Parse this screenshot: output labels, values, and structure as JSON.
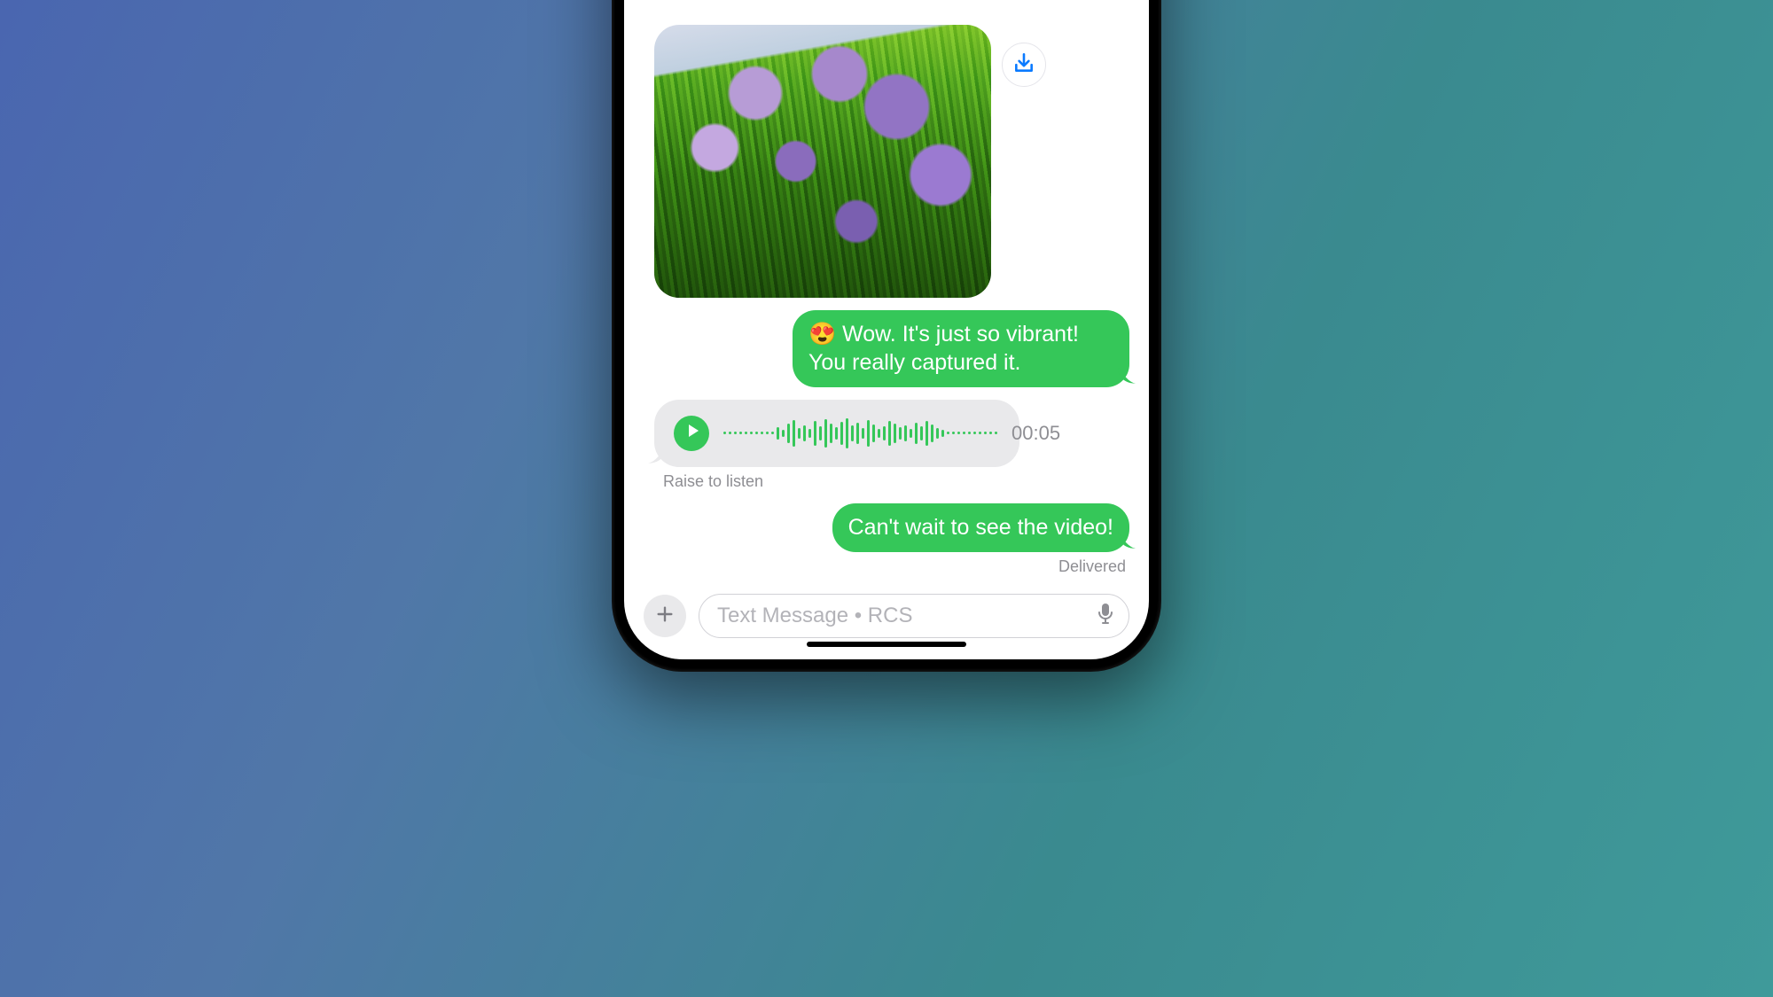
{
  "messages": {
    "photo_alt": "Lavender flowers photo",
    "outgoing1": "😍  Wow. It's just so vibrant! You really captured it.",
    "audio": {
      "duration": "00:05",
      "hint": "Raise to listen"
    },
    "outgoing2": "Can't wait to see the video!",
    "status": "Delivered"
  },
  "input": {
    "placeholder": "Text Message • RCS"
  },
  "colors": {
    "green": "#35c759",
    "gray_bubble": "#e9e9eb",
    "gray_text": "#8e8e93"
  },
  "waveform_heights": [
    3,
    3,
    3,
    3,
    3,
    3,
    3,
    3,
    3,
    3,
    14,
    8,
    22,
    30,
    12,
    18,
    10,
    28,
    16,
    32,
    22,
    14,
    26,
    34,
    18,
    24,
    12,
    30,
    20,
    10,
    16,
    28,
    22,
    14,
    18,
    10,
    24,
    16,
    28,
    20,
    12,
    8,
    3,
    3,
    3,
    3,
    3,
    3,
    3,
    3,
    3,
    3
  ]
}
